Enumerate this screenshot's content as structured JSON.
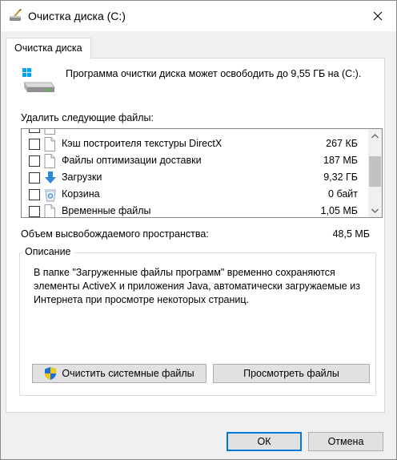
{
  "window": {
    "title": "Очистка диска  (C:)",
    "tab_label": "Очистка диска"
  },
  "intro": {
    "text": "Программа очистки диска может освободить до 9,55 ГБ на (C:)."
  },
  "files": {
    "label": "Удалить следующие файлы:",
    "items": [
      {
        "name": "",
        "size": "",
        "checked": false,
        "icon": "file-icon"
      },
      {
        "name": "Кэш построителя текстуры DirectX",
        "size": "267 КБ",
        "checked": false,
        "icon": "file-icon"
      },
      {
        "name": "Файлы оптимизации доставки",
        "size": "187 МБ",
        "checked": false,
        "icon": "file-icon"
      },
      {
        "name": "Загрузки",
        "size": "9,32 ГБ",
        "checked": false,
        "icon": "download-icon"
      },
      {
        "name": "Корзина",
        "size": "0 байт",
        "checked": false,
        "icon": "recycle-bin-icon"
      },
      {
        "name": "Временные файлы",
        "size": "1,05 МБ",
        "checked": false,
        "icon": "file-icon"
      },
      {
        "name": "",
        "size": "",
        "checked": false,
        "icon": "file-icon"
      }
    ],
    "scroll_position": 0.45
  },
  "space": {
    "label": "Объем высвобождаемого пространства:",
    "value": "48,5 МБ"
  },
  "description": {
    "legend": "Описание",
    "text": "В папке \"Загруженные файлы программ\" временно сохраняются элементы ActiveX и приложения Java, автоматически загружаемые из Интернета при просмотре некоторых страниц."
  },
  "buttons": {
    "clean_system": "Очистить системные файлы",
    "view_files": "Просмотреть файлы",
    "ok": "ОК",
    "cancel": "Отмена"
  },
  "colors": {
    "accent": "#0078d7",
    "shield_blue": "#1e6fd9",
    "shield_yellow": "#f2c811"
  }
}
